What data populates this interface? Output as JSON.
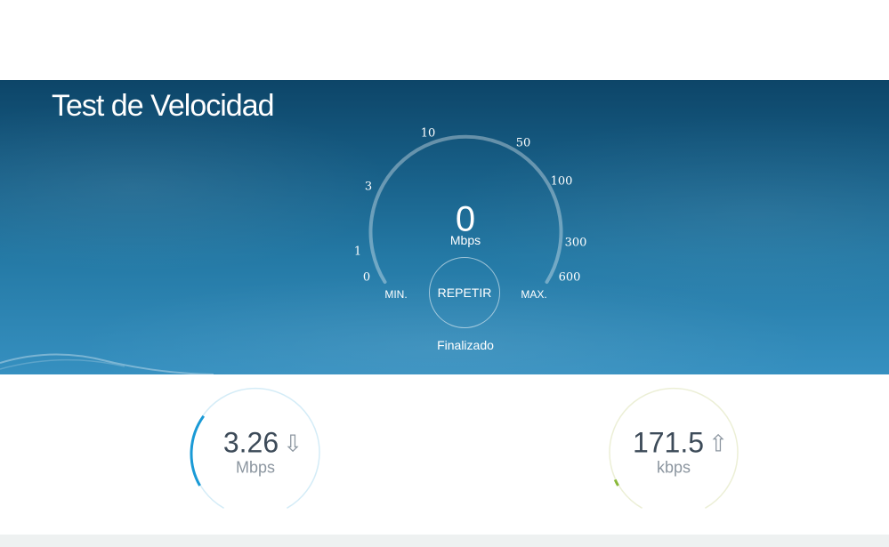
{
  "page": {
    "title": "Test de Velocidad"
  },
  "gauge": {
    "scale": [
      "0",
      "1",
      "3",
      "10",
      "50",
      "100",
      "300",
      "600"
    ],
    "value": "0",
    "unit": "Mbps",
    "min_label": "MIN.",
    "max_label": "MAX.",
    "button_label": "REPETIR",
    "status": "Finalizado"
  },
  "results": {
    "download": {
      "value": "3.26",
      "unit": "Mbps",
      "arrow": "⇩",
      "fraction": 0.22,
      "color": "#1a9ad6"
    },
    "upload": {
      "value": "171.5",
      "unit": "kbps",
      "arrow": "⇧",
      "fraction": 0.02,
      "color": "#8ab93a"
    }
  }
}
